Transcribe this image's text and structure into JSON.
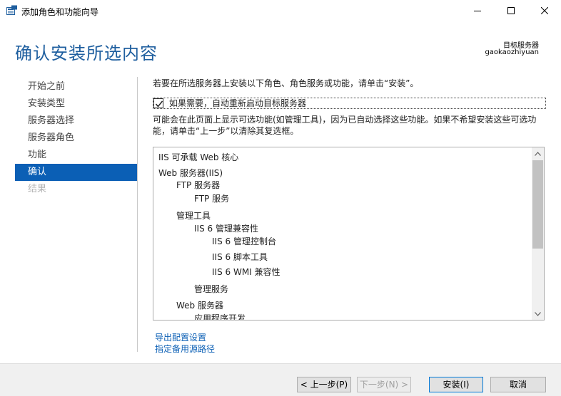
{
  "window": {
    "title": "添加角色和功能向导",
    "minimize_label": "—",
    "maximize_label": "☐",
    "close_label": "✕"
  },
  "header": {
    "page_title": "确认安装所选内容",
    "target_label": "目标服务器",
    "target_name": "gaokaozhiyuan"
  },
  "nav": {
    "items": [
      {
        "label": "开始之前",
        "state": "normal"
      },
      {
        "label": "安装类型",
        "state": "normal"
      },
      {
        "label": "服务器选择",
        "state": "normal"
      },
      {
        "label": "服务器角色",
        "state": "normal"
      },
      {
        "label": "功能",
        "state": "normal"
      },
      {
        "label": "确认",
        "state": "active"
      },
      {
        "label": "结果",
        "state": "disabled"
      }
    ]
  },
  "main": {
    "instruction": "若要在所选服务器上安装以下角色、角色服务或功能，请单击“安装”。",
    "restart_checkbox": {
      "label": "如果需要，自动重新启动目标服务器",
      "checked": true
    },
    "note": "可能会在此页面上显示可选功能(如管理工具)，因为已自动选择这些功能。如果不希望安装这些可选功能，请单击“上一步”以清除其复选框。",
    "features": [
      {
        "label": "IIS 可承载 Web 核心",
        "level": 0
      },
      {
        "label": "Web 服务器(IIS)",
        "level": 0
      },
      {
        "label": "FTP 服务器",
        "level": 1
      },
      {
        "label": "FTP 服务",
        "level": 2
      },
      {
        "label": "管理工具",
        "level": 1
      },
      {
        "label": "IIS 6 管理兼容性",
        "level": 2
      },
      {
        "label": "IIS 6 管理控制台",
        "level": 3
      },
      {
        "label": "IIS 6 脚本工具",
        "level": 3
      },
      {
        "label": "IIS 6 WMI 兼容性",
        "level": 3
      },
      {
        "label": "管理服务",
        "level": 2
      },
      {
        "label": "Web 服务器",
        "level": 1
      },
      {
        "label": "应用程序开发",
        "level": 2
      }
    ],
    "export_link": "导出配置设置",
    "source_link": "指定备用源路径"
  },
  "footer": {
    "prev_label": "< 上一步(P)",
    "next_label": "下一步(N) >",
    "install_label": "安装(I)",
    "cancel_label": "取消"
  },
  "colors": {
    "accent": "#0b5fb5",
    "title_blue": "#1f5f9f",
    "footer_bg": "#f0f0f0"
  }
}
